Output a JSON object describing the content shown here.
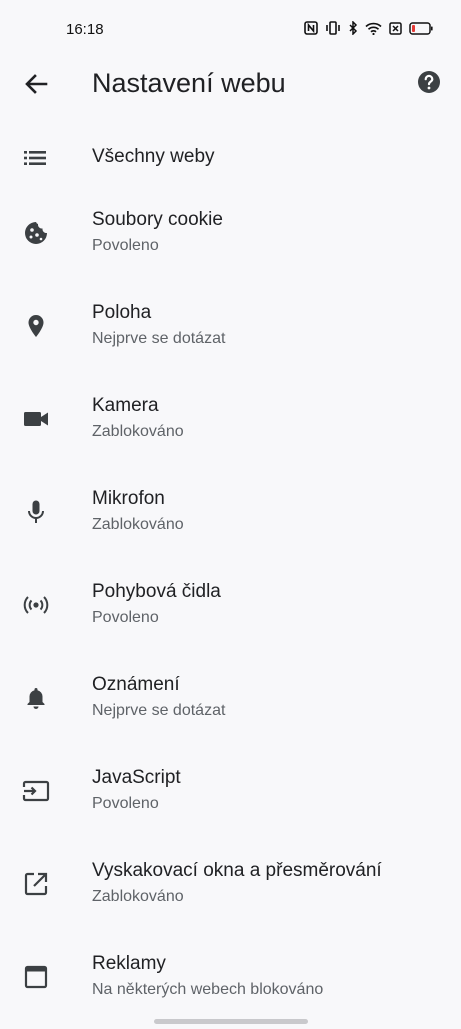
{
  "status_bar": {
    "time": "16:18"
  },
  "header": {
    "title": "Nastavení webu"
  },
  "settings": {
    "all_sites": {
      "label": "Všechny weby",
      "icon": "list-icon"
    },
    "items": [
      {
        "title": "Soubory cookie",
        "subtitle": "Povoleno",
        "icon": "cookie-icon"
      },
      {
        "title": "Poloha",
        "subtitle": "Nejprve se dotázat",
        "icon": "location-pin-icon"
      },
      {
        "title": "Kamera",
        "subtitle": "Zablokováno",
        "icon": "videocam-icon"
      },
      {
        "title": "Mikrofon",
        "subtitle": "Zablokováno",
        "icon": "microphone-icon"
      },
      {
        "title": "Pohybová čidla",
        "subtitle": "Povoleno",
        "icon": "sensors-icon"
      },
      {
        "title": "Oznámení",
        "subtitle": "Nejprve se dotázat",
        "icon": "bell-icon"
      },
      {
        "title": "JavaScript",
        "subtitle": "Povoleno",
        "icon": "input-icon"
      },
      {
        "title": "Vyskakovací okna a přesměrování",
        "subtitle": "Zablokováno",
        "icon": "open-in-new-icon"
      },
      {
        "title": "Reklamy",
        "subtitle": "Na některých webech blokováno",
        "icon": "window-icon"
      }
    ]
  },
  "colors": {
    "background": "#f8f8fa",
    "icon": "#3c4043",
    "title": "#202124",
    "subtitle": "#5f6368",
    "battery_low": "#e53935"
  }
}
